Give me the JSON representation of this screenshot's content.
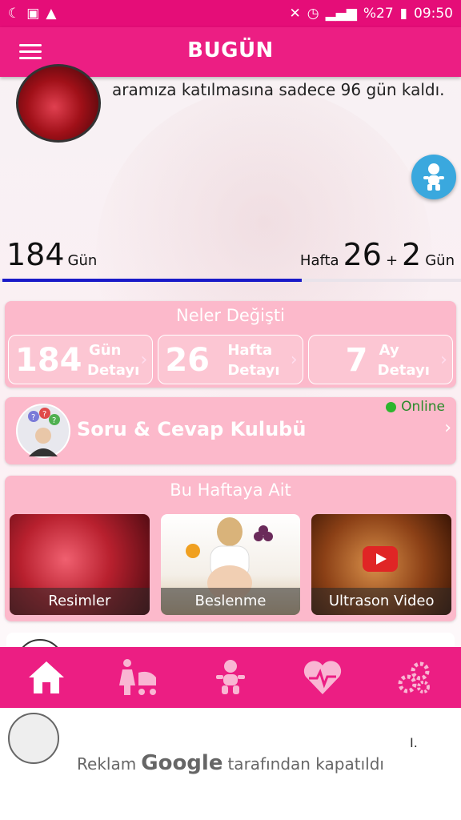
{
  "status_bar": {
    "battery": "%27",
    "time": "09:50",
    "left_icons": [
      "moon-icon",
      "bag-icon",
      "warning-icon"
    ],
    "right_icons": [
      "mute-icon",
      "alarm-icon",
      "network-icon",
      "signal-icon",
      "battery-icon"
    ]
  },
  "app_bar": {
    "title": "BUGÜN"
  },
  "header": {
    "countdown_text": "aramıza katılmasına sadece 96 gün kaldı."
  },
  "counter": {
    "days_value": "184",
    "days_unit": "Gün",
    "week_prefix": "Hafta",
    "week_value": "26",
    "plus": "+",
    "extra_days": "2",
    "extra_unit": "Gün",
    "progress_fraction": 0.65
  },
  "changes": {
    "title": "Neler Değişti",
    "items": [
      {
        "number": "184",
        "unit": "Gün",
        "detail": "Detayı"
      },
      {
        "number": "26",
        "unit": "Hafta",
        "detail": "Detayı"
      },
      {
        "number": "7",
        "unit": "Ay",
        "detail": "Detayı"
      }
    ]
  },
  "qa": {
    "title": "Soru & Cevap Kulubü",
    "status": "Online"
  },
  "week_section": {
    "title": "Bu Haftaya Ait",
    "media": [
      {
        "label": "Resimler"
      },
      {
        "label": "Beslenme"
      },
      {
        "label": "Ultrason Video"
      }
    ]
  },
  "bottom_nav": [
    "home-icon",
    "mother-stroller-icon",
    "baby-icon",
    "heart-pulse-icon",
    "settings-gears-icon"
  ],
  "footer": {
    "roman_mark": "I.",
    "ad_prefix": "Reklam",
    "ad_brand": "Google",
    "ad_suffix": "tarafından kapatıldı"
  },
  "colors": {
    "primary": "#ec1e83",
    "card": "#fcb9cb",
    "progress": "#1a1ac8",
    "fab": "#3aa8de",
    "online": "#2db52d"
  }
}
